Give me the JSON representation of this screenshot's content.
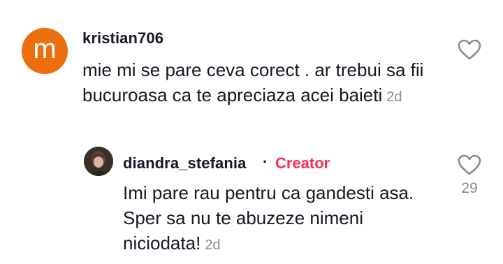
{
  "comment": {
    "avatar_letter": "m",
    "avatar_color": "#ec6f0f",
    "username": "kristian706",
    "text": "mie mi se pare ceva corect . ar trebui sa fii bucuroasa ca te apreciaza acei baieti",
    "time": "2d",
    "like_icon": "heart-outline-icon"
  },
  "reply": {
    "username": "diandra_stefania",
    "separator": "·",
    "badge": "Creator",
    "badge_color": "#fe2c55",
    "text": "Imi pare rau pentru ca gandesti asa. Sper sa nu te abuzeze nimeni niciodata!",
    "time": "2d",
    "like_icon": "heart-outline-icon",
    "likes": "29"
  }
}
